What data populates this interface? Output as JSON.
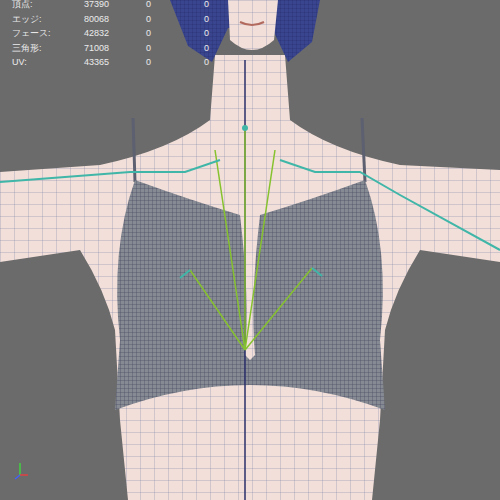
{
  "viewport": {
    "hud": [
      {
        "label": "頂点:",
        "values": [
          "37390",
          "0",
          "0"
        ]
      },
      {
        "label": "エッジ:",
        "values": [
          "80068",
          "0",
          "0"
        ]
      },
      {
        "label": "フェース:",
        "values": [
          "42832",
          "0",
          "0"
        ]
      },
      {
        "label": "三角形:",
        "values": [
          "71008",
          "0",
          "0"
        ]
      },
      {
        "label": "UV:",
        "values": [
          "43365",
          "0",
          "0"
        ]
      }
    ]
  }
}
